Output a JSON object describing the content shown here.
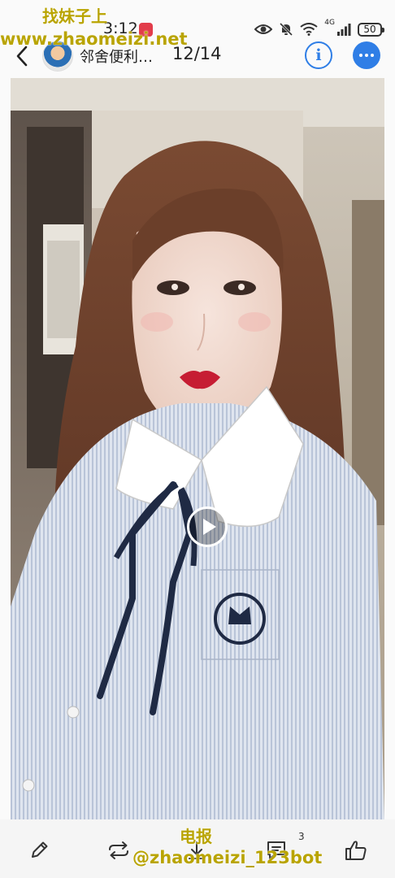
{
  "status_bar": {
    "time": "3:12",
    "network": "4G",
    "battery": "50"
  },
  "header": {
    "user_name": "邻舍便利…",
    "page_counter": "12/14",
    "info_icon": "i"
  },
  "watermarks": {
    "top_title": "找妹子上",
    "top_url": "www.zhaomeizi.net",
    "bottom_title": "电报",
    "bottom_handle": "@zhaomeizi_123bot"
  },
  "toolbar": {
    "comment_count": "3"
  },
  "icons": {
    "back": "chevron-left-icon",
    "info": "info-icon",
    "more": "more-dots-icon",
    "play": "play-icon",
    "edit": "pencil-icon",
    "share": "repost-icon",
    "download": "download-icon",
    "comment": "comment-icon",
    "like": "thumbs-up-icon"
  },
  "colors": {
    "accent": "#2f7ee6",
    "watermark": "#b9a400",
    "app_badge": "#e23c4a"
  }
}
